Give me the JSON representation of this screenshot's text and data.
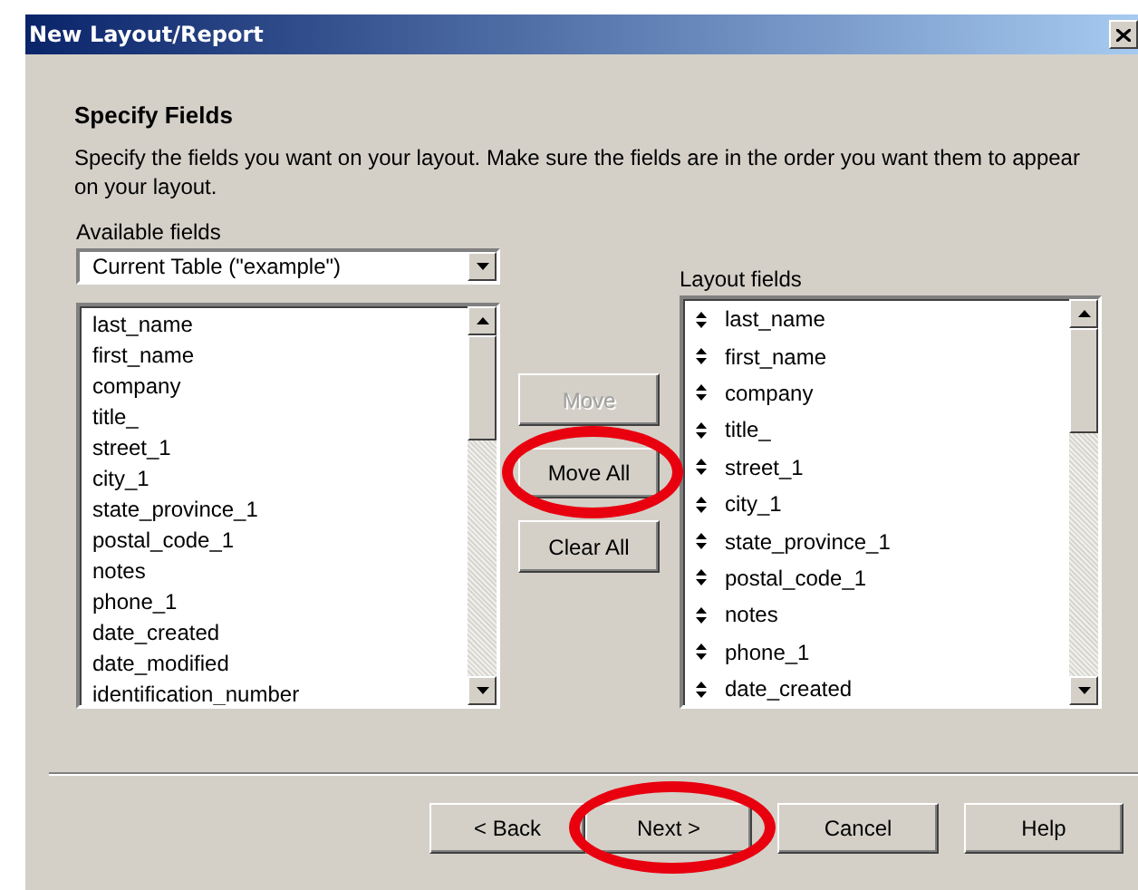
{
  "window": {
    "title": "New Layout/Report"
  },
  "heading": "Specify Fields",
  "instructions": "Specify the fields you want on your layout. Make sure the fields are in the order you want them to appear on your layout.",
  "available": {
    "label": "Available fields",
    "table_select": {
      "value": "Current Table (\"example\")"
    },
    "fields": [
      "last_name",
      "first_name",
      "company",
      "title_",
      "street_1",
      "city_1",
      "state_province_1",
      "postal_code_1",
      "notes",
      "phone_1",
      "date_created",
      "date_modified",
      "identification_number"
    ]
  },
  "move_buttons": [
    {
      "label": "Move",
      "disabled": true,
      "highlighted": false
    },
    {
      "label": "Move All",
      "disabled": false,
      "highlighted": true
    },
    {
      "label": "Clear All",
      "disabled": false,
      "highlighted": false
    }
  ],
  "layout": {
    "label": "Layout fields",
    "fields": [
      "last_name",
      "first_name",
      "company",
      "title_",
      "street_1",
      "city_1",
      "state_province_1",
      "postal_code_1",
      "notes",
      "phone_1",
      "date_created"
    ]
  },
  "nav_buttons": [
    {
      "label": "< Back",
      "highlighted": false
    },
    {
      "label": "Next >",
      "highlighted": true
    },
    {
      "label": "Cancel",
      "highlighted": false
    },
    {
      "label": "Help",
      "highlighted": false
    }
  ]
}
